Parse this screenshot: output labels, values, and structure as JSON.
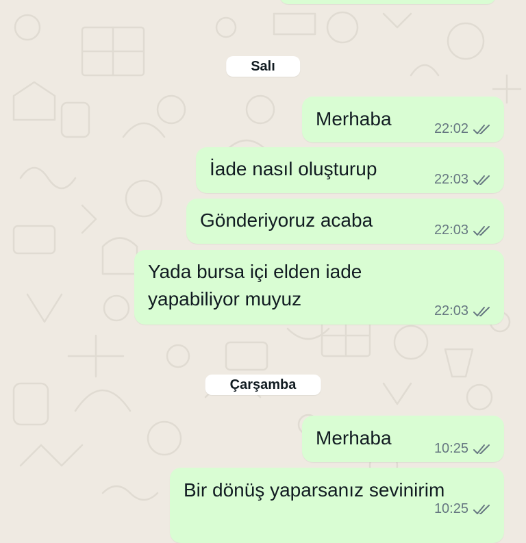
{
  "chat": {
    "groups": [
      {
        "date_label": "Salı",
        "messages": [
          {
            "text": "Merhaba",
            "time": "22:02",
            "status_icon": "double-check-icon"
          },
          {
            "text": "İade nasıl oluşturup",
            "time": "22:03",
            "status_icon": "double-check-icon"
          },
          {
            "text": "Gönderiyoruz acaba",
            "time": "22:03",
            "status_icon": "double-check-icon"
          },
          {
            "text": "Yada bursa içi elden iade\nyapabiliyor muyuz",
            "time": "22:03",
            "status_icon": "double-check-icon"
          }
        ]
      },
      {
        "date_label": "Çarşamba",
        "messages": [
          {
            "text": "Merhaba",
            "time": "10:25",
            "status_icon": "double-check-icon"
          },
          {
            "text": "Bir dönüş yaparsanız sevinirim",
            "time": "10:25",
            "status_icon": "double-check-icon"
          }
        ]
      }
    ]
  },
  "colors": {
    "background": "#efeae2",
    "outgoing_bubble": "#d9fdd3",
    "date_pill": "#ffffff",
    "text": "#111b21",
    "meta_text": "#667781"
  }
}
